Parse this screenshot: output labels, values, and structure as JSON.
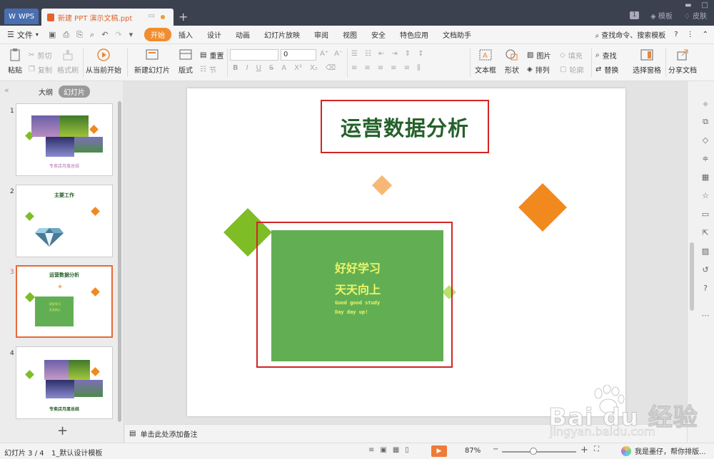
{
  "titlebar": {
    "wps_label": "WPS",
    "doc_tab_label": "新建 PPT 演示文稿.ppt",
    "template_label": "模板",
    "skin_label": "皮肤",
    "badge_count": "1"
  },
  "menu": {
    "file_label": "文件",
    "items": [
      "开始",
      "插入",
      "设计",
      "动画",
      "幻灯片放映",
      "审阅",
      "视图",
      "安全",
      "特色应用",
      "文档助手"
    ],
    "search_label": "查找命令、搜索模板"
  },
  "ribbon": {
    "paste": "粘贴",
    "cut": "剪切",
    "copy": "复制",
    "format_painter": "格式刷",
    "from_current": "从当前开始",
    "new_slide": "新建幻灯片",
    "layout": "版式",
    "reset": "重置",
    "section": "节",
    "font_size": "0",
    "textbox": "文本框",
    "shape": "形状",
    "picture": "图片",
    "fill": "填充",
    "arrange": "排列",
    "outline": "轮廓",
    "find": "查找",
    "replace": "替换",
    "select_pane": "选择窗格",
    "share_doc": "分享文档"
  },
  "left_panel": {
    "outline_tab": "大纲",
    "slides_tab": "幻灯片",
    "thumbs": [
      {
        "num": "1",
        "caption": "专卖店月度总结"
      },
      {
        "num": "2",
        "title": "主要工作"
      },
      {
        "num": "3",
        "title": "运营数据分析",
        "line1": "好好学习",
        "line2": "天天向上"
      },
      {
        "num": "4",
        "caption": "专卖店月度总结"
      }
    ]
  },
  "slide": {
    "title": "运营数据分析",
    "line1": "好好学习",
    "line2": "天天向上",
    "line3": "Good good study",
    "line4": "Day day up!"
  },
  "notes": {
    "placeholder": "单击此处添加备注"
  },
  "status": {
    "slide_count": "幻灯片 3 / 4",
    "template": "1_默认设计模板",
    "zoom": "87%",
    "assistant": "我是墨仔，帮你排版..."
  },
  "watermark": {
    "brand": "Bai du 经验",
    "url": "jingyan.baidu.com"
  },
  "colors": {
    "accent_orange": "#f18d2e",
    "selection_red": "#d32424",
    "title_green": "#25612a",
    "box_green": "#62af53",
    "text_yellow": "#eef56a",
    "diamond_green": "#7ebd25",
    "diamond_orange": "#f1891e",
    "diamond_peach": "#f7b877"
  }
}
